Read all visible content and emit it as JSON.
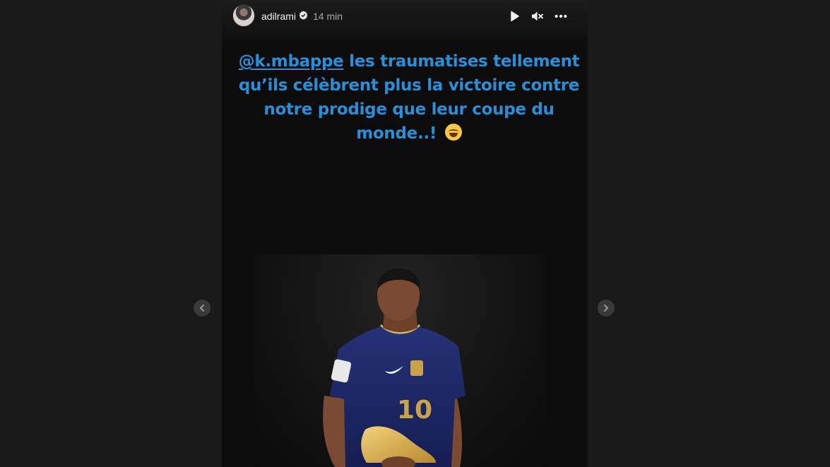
{
  "story": {
    "username": "adilrami",
    "time": "14 min",
    "caption_mention": "@k.mbappe",
    "caption_text": " les traumatises tellement qu’ils célèbrent plus la victoire contre notre prodige que leur coupe du monde..!",
    "emoji": "face-with-tears-of-joy",
    "jersey_number": "10"
  },
  "colors": {
    "page_bg": "#1a1a1a",
    "story_bg": "#0d0c0c",
    "caption": "#2b8fd8",
    "jersey": "#1f2a6b"
  },
  "icons": {
    "verified": "verified-badge-icon",
    "play": "play-icon",
    "mute": "mute-icon",
    "more": "more-icon",
    "prev": "chevron-left-icon",
    "next": "chevron-right-icon"
  }
}
